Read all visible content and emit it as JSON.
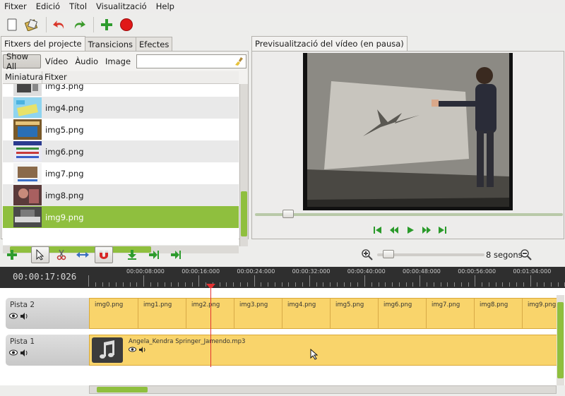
{
  "menu": {
    "items": [
      {
        "label": "Fitxer"
      },
      {
        "label": "Edició"
      },
      {
        "label": "Títol"
      },
      {
        "label": "Visualització"
      },
      {
        "label": "Help"
      }
    ]
  },
  "left_tabs": [
    "Fitxers del projecte",
    "Transicions",
    "Efectes"
  ],
  "right_tab": "Previsualització del vídeo (en pausa)",
  "filters": [
    "Show All",
    "Vídeo",
    "Àudio",
    "Image"
  ],
  "search": {
    "value": ""
  },
  "list_headers": {
    "thumb": "Miniatura",
    "file": "Fitxer"
  },
  "files": [
    {
      "name": "img3.png",
      "selected": false
    },
    {
      "name": "img4.png",
      "selected": false
    },
    {
      "name": "img5.png",
      "selected": false
    },
    {
      "name": "img6.png",
      "selected": false
    },
    {
      "name": "img7.png",
      "selected": false
    },
    {
      "name": "img8.png",
      "selected": false
    },
    {
      "name": "img9.png",
      "selected": true
    }
  ],
  "preview": {
    "seek_fraction": 0.09
  },
  "zoom": {
    "label": "8 segons",
    "fraction": 0.05
  },
  "timeline": {
    "timecode": "00:00:17:026",
    "ruler_labels": [
      "00:00:08:000",
      "00:00:16:000",
      "00:00:24:000",
      "00:00:32:000",
      "00:00:40:000",
      "00:00:48:000",
      "00:00:56:000",
      "00:01:04:000"
    ],
    "tracks": [
      {
        "name": "Pista 2",
        "clips": [
          "img0.png",
          "img1.png",
          "img2.png",
          "img3.png",
          "img4.png",
          "img5.png",
          "img6.png",
          "img7.png",
          "img8.png",
          "img9.png"
        ]
      },
      {
        "name": "Pista 1",
        "audio_clip": "Angela_Kendra Springer_Jamendo.mp3"
      }
    ]
  },
  "colors": {
    "selection": "#8fbf3e",
    "clip": "#f9d46b",
    "playhead": "#e23131"
  }
}
